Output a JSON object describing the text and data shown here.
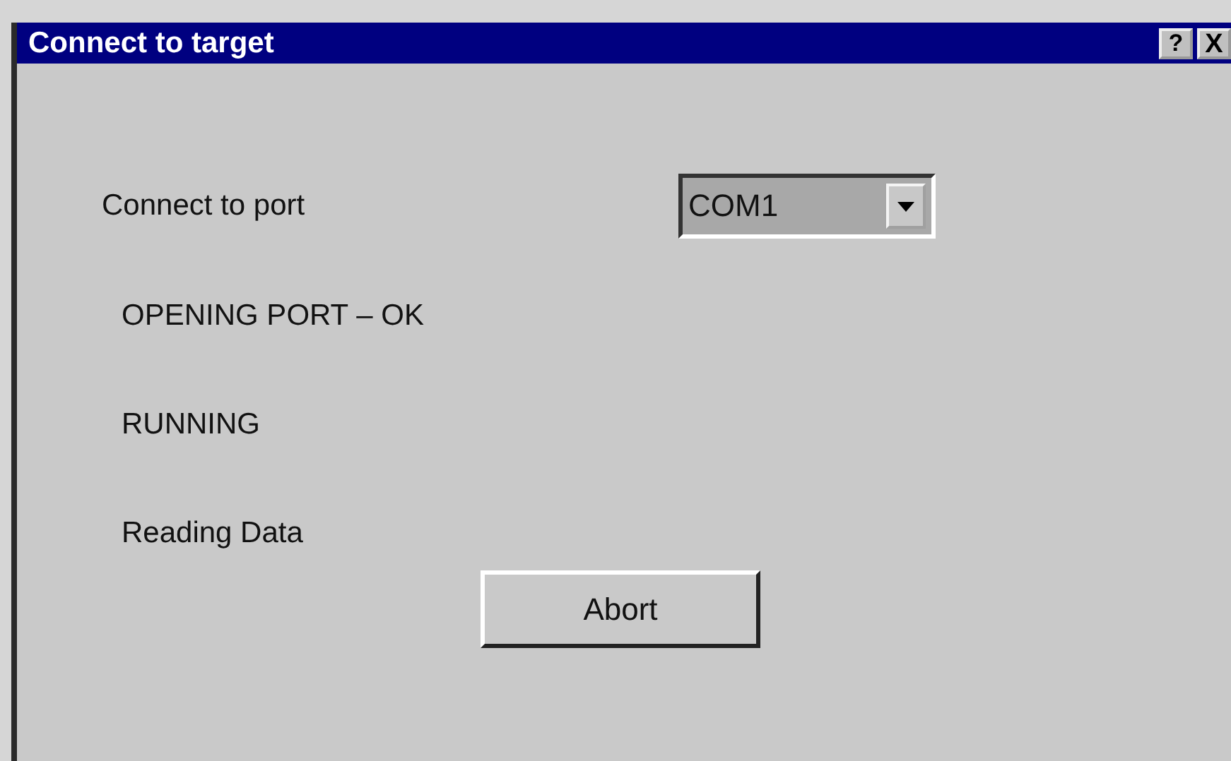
{
  "window": {
    "title": "Connect to target",
    "title_buttons": [
      {
        "kind": "help",
        "label": "?"
      },
      {
        "kind": "close",
        "label": "X"
      }
    ]
  },
  "port": {
    "label": "Connect to port",
    "value": "COM1"
  },
  "status_lines": [
    "OPENING PORT – OK",
    "RUNNING",
    "Reading Data"
  ],
  "buttons": [
    "Abort"
  ]
}
